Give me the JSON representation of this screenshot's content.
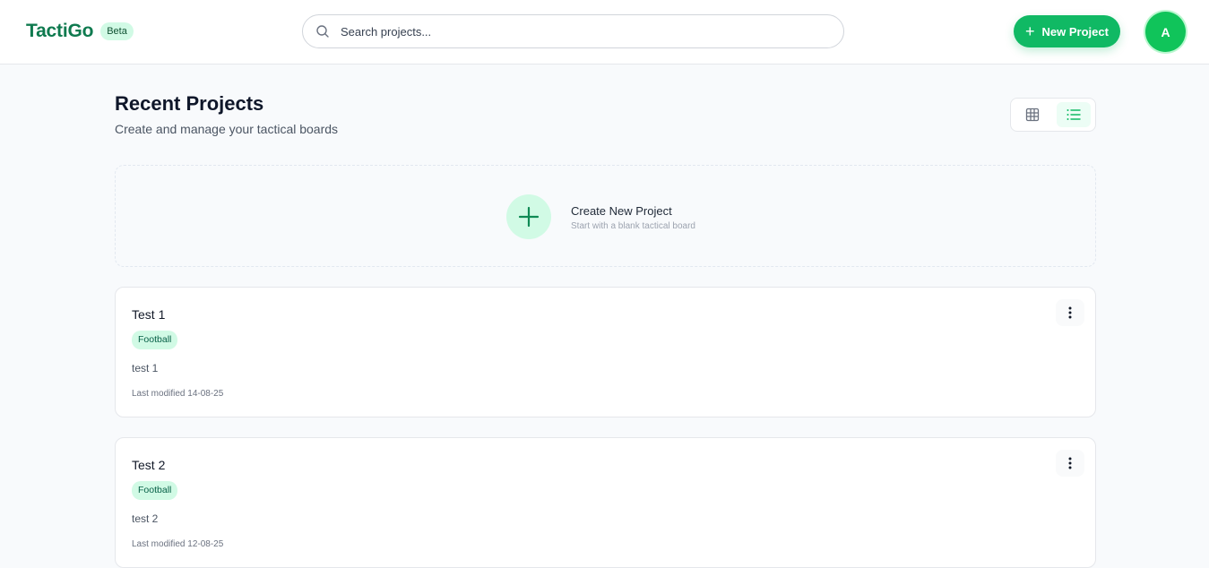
{
  "header": {
    "brand_name": "TactiGo",
    "badge": "Beta",
    "search_placeholder": "Search projects...",
    "new_project_label": "New Project",
    "avatar_initial": "A"
  },
  "main": {
    "title": "Recent Projects",
    "subtitle": "Create and manage your tactical boards",
    "view_modes": [
      {
        "name": "grid",
        "icon": "grid-icon",
        "active": false
      },
      {
        "name": "list",
        "icon": "list-icon",
        "active": true
      }
    ],
    "create_card": {
      "title": "Create New Project",
      "subtitle": "Start with a blank tactical board"
    },
    "projects": [
      {
        "title": "Test 1",
        "tag": "Football",
        "description": "test 1",
        "modified": "Last modified 14-08-25"
      },
      {
        "title": "Test 2",
        "tag": "Football",
        "description": "test 2",
        "modified": "Last modified 12-08-25"
      }
    ]
  },
  "colors": {
    "brand": "#0f7a4f",
    "accent": "#10b964",
    "tag_bg": "#d1fae5"
  }
}
